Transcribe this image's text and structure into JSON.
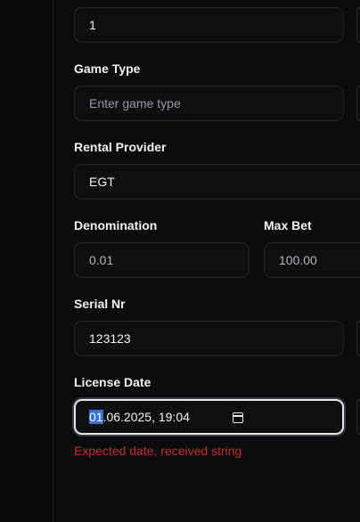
{
  "fields": {
    "top_value": "1",
    "game_type": {
      "label": "Game Type",
      "placeholder": "Enter game type"
    },
    "rental_provider": {
      "label": "Rental Provider",
      "value": "EGT"
    },
    "denomination": {
      "label": "Denomination",
      "value": "0.01"
    },
    "max_bet": {
      "label": "Max Bet",
      "value": "100.00"
    },
    "serial_nr": {
      "label": "Serial Nr",
      "value": "123123"
    },
    "license_date": {
      "label": "License Date",
      "value_selected": "01",
      "value_rest": ".06.2025, 19:04",
      "error": "Expected date, received string"
    }
  },
  "colors": {
    "error": "#c0302f",
    "selection": "#3b6fd4",
    "background": "#0b0b0d"
  }
}
